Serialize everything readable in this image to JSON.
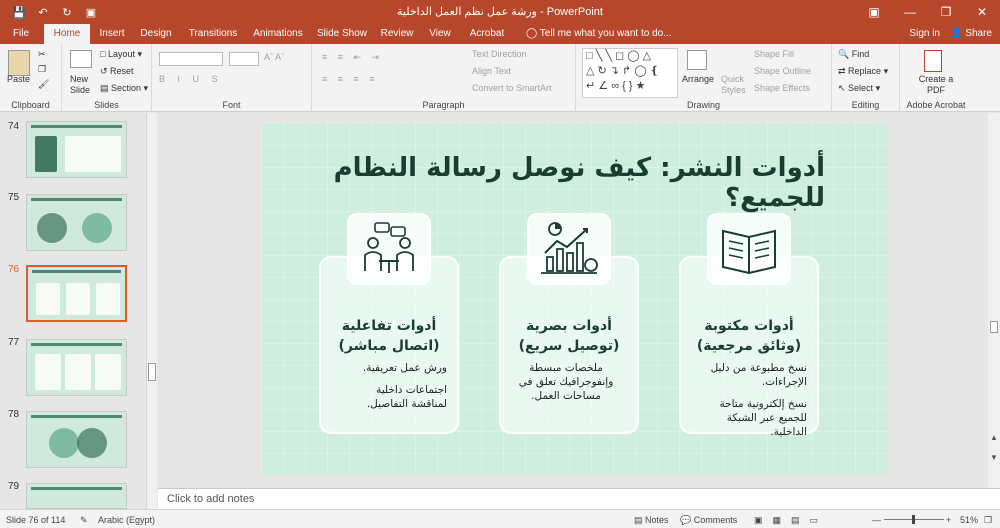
{
  "window": {
    "title": "ورشة عمل نظم العمل الداخلية - PowerPoint"
  },
  "tabs": [
    "File",
    "Home",
    "Insert",
    "Design",
    "Transitions",
    "Animations",
    "Slide Show",
    "Review",
    "View",
    "Acrobat"
  ],
  "tell_me": "Tell me what you want to do...",
  "sign_in": "Sign in",
  "share": "Share",
  "ribbon": {
    "clipboard": {
      "label": "Clipboard",
      "paste": "Paste"
    },
    "slides": {
      "label": "Slides",
      "new_slide": "New Slide",
      "layout": "Layout",
      "reset": "Reset",
      "section": "Section"
    },
    "font": {
      "label": "Font"
    },
    "paragraph": {
      "label": "Paragraph",
      "text_direction": "Text Direction",
      "align_text": "Align Text",
      "convert_smartart": "Convert to SmartArt"
    },
    "drawing": {
      "label": "Drawing",
      "arrange": "Arrange",
      "quick_styles": "Quick Styles",
      "shape_fill": "Shape Fill",
      "shape_outline": "Shape Outline",
      "shape_effects": "Shape Effects"
    },
    "editing": {
      "label": "Editing",
      "find": "Find",
      "replace": "Replace",
      "select": "Select"
    },
    "acrobat": {
      "label": "Adobe Acrobat",
      "create_pdf": "Create a PDF"
    }
  },
  "thumbnails": [
    {
      "num": "74"
    },
    {
      "num": "75"
    },
    {
      "num": "76"
    },
    {
      "num": "77"
    },
    {
      "num": "78"
    },
    {
      "num": "79"
    }
  ],
  "slide": {
    "title": "أدوات النشر: كيف نوصل رسالة النظام للجميع؟",
    "cards": [
      {
        "title1": "أدوات مكتوبة",
        "title2": "(وثائق مرجعية)",
        "text": [
          "نسخ مطبوعة من دليل",
          "الإجراءات.",
          "",
          "نسخ إلكترونية متاحة",
          "للجميع عبر الشبكة",
          "الداخلية."
        ],
        "icon": "book-icon"
      },
      {
        "title1": "أدوات بصرية",
        "title2": "(توصيل سريع)",
        "text": [
          "ملخصات مبسطة",
          "وإنفوجرافيك تعلق في",
          "مساحات العمل."
        ],
        "icon": "chart-icon"
      },
      {
        "title1": "أدوات تفاعلية",
        "title2": "(اتصال مباشر)",
        "text": [
          "ورش عمل تعريفية.",
          "",
          "اجتماعات داخلية",
          "لمناقشة التفاصيل."
        ],
        "icon": "meeting-icon"
      }
    ]
  },
  "notes_placeholder": "Click to add notes",
  "status": {
    "slide": "Slide 76 of 114",
    "language": "Arabic (Egypt)",
    "notes": "Notes",
    "comments": "Comments",
    "zoom": "51%"
  },
  "colors": {
    "accent": "#b7472a",
    "slide_bg": "#cfeee0",
    "title": "#1a3d31"
  }
}
